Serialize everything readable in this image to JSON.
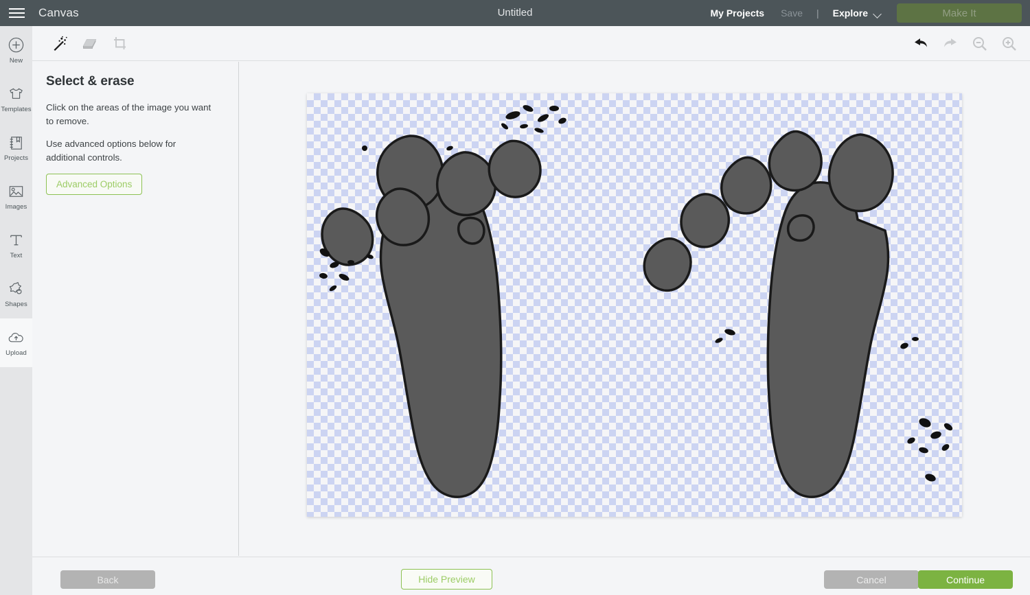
{
  "topbar": {
    "menu_icon": "hamburger-menu-icon",
    "app_name": "Canvas",
    "doc_title": "Untitled",
    "my_projects_label": "My Projects",
    "save_label": "Save",
    "separator": "|",
    "explore_label": "Explore",
    "explore_chevron_icon": "chevron-down-icon",
    "make_it_label": "Make It",
    "make_it_enabled": false,
    "bg_color": "#4c5559",
    "make_it_bg_color": "#5d7344"
  },
  "sidebar": {
    "items": [
      {
        "label": "New",
        "icon": "plus-circle-icon",
        "active": false
      },
      {
        "label": "Templates",
        "icon": "tshirt-icon",
        "active": false
      },
      {
        "label": "Projects",
        "icon": "notebook-icon",
        "active": false
      },
      {
        "label": "Images",
        "icon": "picture-icon",
        "active": false
      },
      {
        "label": "Text",
        "icon": "text-type-icon",
        "active": false
      },
      {
        "label": "Shapes",
        "icon": "star-shape-icon",
        "active": false
      },
      {
        "label": "Upload",
        "icon": "cloud-upload-icon",
        "active": true
      }
    ],
    "bg_color": "#e4e5e7",
    "active_bg_color": "#f7f8f9"
  },
  "toolbar": {
    "left_tools": [
      {
        "name": "magic-wand-icon",
        "title": "Select & erase",
        "active": true
      },
      {
        "name": "eraser-icon",
        "title": "Eraser",
        "active": false
      },
      {
        "name": "crop-icon",
        "title": "Crop",
        "active": false
      }
    ],
    "right_tools": [
      {
        "name": "undo-icon",
        "title": "Undo",
        "active": true
      },
      {
        "name": "redo-icon",
        "title": "Redo",
        "active": false
      },
      {
        "name": "zoom-out-icon",
        "title": "Zoom Out",
        "active": false
      },
      {
        "name": "zoom-in-icon",
        "title": "Zoom In",
        "active": false
      }
    ]
  },
  "panel": {
    "title": "Select & erase",
    "paragraph_1": "Click on the areas of the image you want to remove.",
    "paragraph_2": "Use advanced options below for additional controls.",
    "advanced_options_label": "Advanced Options",
    "accent_color": "#8cc152"
  },
  "canvas": {
    "checker_color_a": "#ccd4f2",
    "checker_color_b": "#f5f5f7",
    "checker_size_px": 10,
    "artwork_name": "two-footprints-silhouette",
    "artwork_fill_color": "#5a5a5a",
    "artwork_outline_color": "#1a1a1a",
    "board_width": 954,
    "board_height": 617
  },
  "bottombar": {
    "back_label": "Back",
    "back_enabled": false,
    "hide_preview_label": "Hide Preview",
    "cancel_label": "Cancel",
    "continue_label": "Continue",
    "continue_color": "#7cb342",
    "disabled_color": "#b3b3b3"
  }
}
